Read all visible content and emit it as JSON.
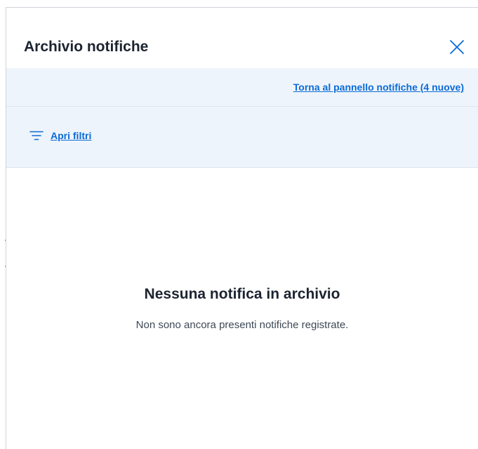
{
  "panel": {
    "title": "Archivio notifiche",
    "close_icon": "close-icon"
  },
  "back_bar": {
    "link_label": "Torna al pannello notifiche (4 nuove)"
  },
  "filters": {
    "icon": "filter-icon",
    "label": "Apri filtri"
  },
  "empty_state": {
    "title": "Nessuna notifica in archivio",
    "description": "Non sono ancora presenti notifiche registrate."
  },
  "colors": {
    "accent": "#0b6bd6",
    "bar_background": "#eef4fb",
    "text_primary": "#1c2430",
    "text_secondary": "#3e4956"
  }
}
